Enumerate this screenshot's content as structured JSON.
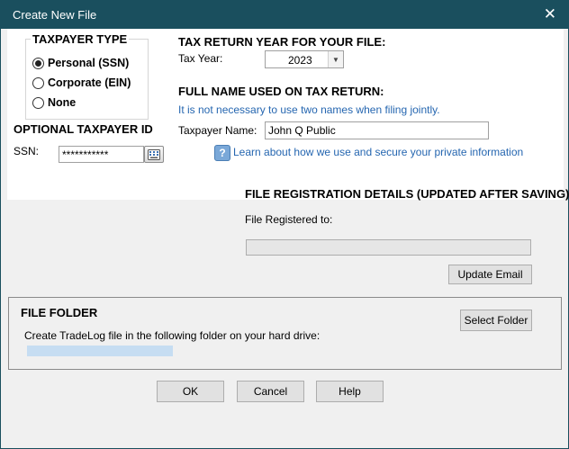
{
  "window": {
    "title": "Create New File"
  },
  "taxpayer_type": {
    "title": "TAXPAYER TYPE",
    "options": [
      {
        "label": "Personal (SSN)",
        "checked": true
      },
      {
        "label": "Corporate (EIN)",
        "checked": false
      },
      {
        "label": "None",
        "checked": false
      }
    ]
  },
  "optional_id": {
    "title": "OPTIONAL TAXPAYER ID",
    "ssn_label": "SSN:",
    "ssn_value": "***********"
  },
  "tax_year": {
    "title": "TAX RETURN YEAR FOR YOUR FILE:",
    "label": "Tax Year:",
    "value": "2023"
  },
  "full_name": {
    "title": "FULL NAME USED ON TAX RETURN:",
    "note": "It is not necessary to use two names when filing jointly.",
    "label": "Taxpayer Name:",
    "value": "John Q Public",
    "learn_link": "Learn about how we use and secure your private information"
  },
  "registration": {
    "title": "FILE REGISTRATION DETAILS (UPDATED AFTER SAVING)",
    "registered_label": "File Registered to:",
    "registered_value": "",
    "update_button": "Update Email"
  },
  "file_folder": {
    "title": "FILE FOLDER",
    "description": "Create TradeLog file in the following folder on your hard drive:",
    "select_button": "Select Folder"
  },
  "footer": {
    "ok": "OK",
    "cancel": "Cancel",
    "help": "Help"
  }
}
